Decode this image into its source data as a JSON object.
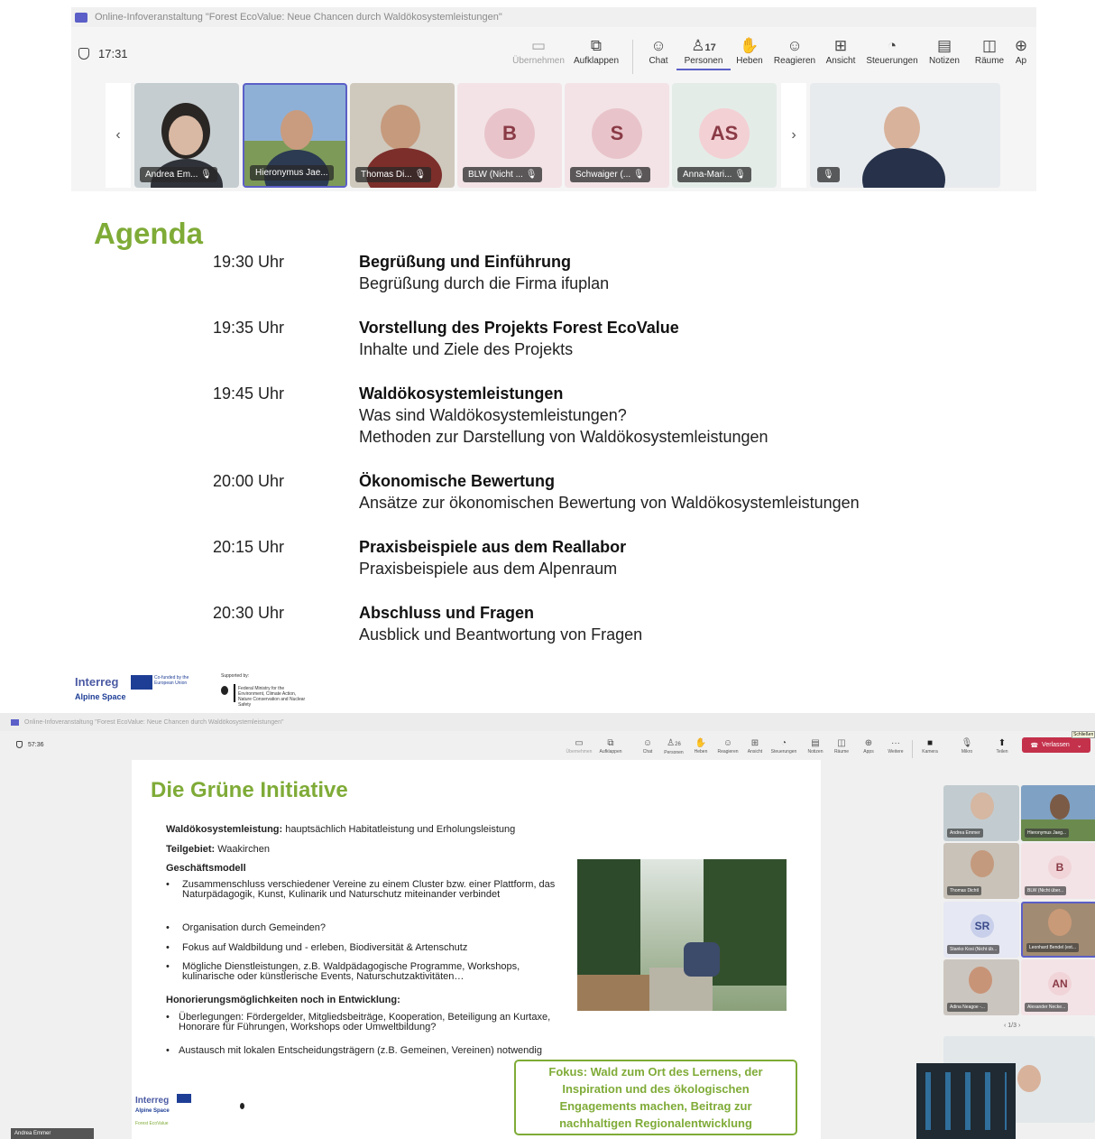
{
  "top": {
    "window_title": "Online-Infoveranstaltung \"Forest EcoValue: Neue Chancen durch Waldökosystemleistungen\"",
    "timer": "17:31",
    "toolbar": [
      {
        "icon": "share-screen-icon",
        "label": "Übernehmen",
        "disabled": true
      },
      {
        "icon": "pop-out-icon",
        "label": "Aufklappen"
      },
      {
        "icon": "chat-icon",
        "label": "Chat"
      },
      {
        "icon": "people-icon",
        "label": "Personen",
        "count": "17",
        "active": true
      },
      {
        "icon": "raise-hand-icon",
        "label": "Heben"
      },
      {
        "icon": "react-icon",
        "label": "Reagieren"
      },
      {
        "icon": "view-icon",
        "label": "Ansicht"
      },
      {
        "icon": "controls-icon",
        "label": "Steuerungen"
      },
      {
        "icon": "notes-icon",
        "label": "Notizen"
      },
      {
        "icon": "rooms-icon",
        "label": "Räume"
      },
      {
        "icon": "apps-icon",
        "label": "Ap"
      }
    ],
    "participants": [
      {
        "name": "Andrea Em...",
        "type": "video"
      },
      {
        "name": "Hieronymus Jae...",
        "type": "video",
        "speaking": true
      },
      {
        "name": "Thomas Di...",
        "type": "video"
      },
      {
        "name": "BLW (Nicht ...",
        "type": "avatar",
        "initials": "B"
      },
      {
        "name": "Schwaiger (...",
        "type": "avatar",
        "initials": "S"
      },
      {
        "name": "Anna-Mari...",
        "type": "avatar",
        "initials": "AS"
      }
    ],
    "slide": {
      "title": "Agenda",
      "items": [
        {
          "time": "19:30 Uhr",
          "heading": "Begrüßung und Einführung",
          "lines": [
            "Begrüßung durch die Firma ifuplan"
          ]
        },
        {
          "time": "19:35 Uhr",
          "heading": "Vorstellung des Projekts Forest EcoValue",
          "lines": [
            "Inhalte und Ziele des Projekts"
          ]
        },
        {
          "time": "19:45 Uhr",
          "heading": "Waldökosystemleistungen",
          "lines": [
            "Was sind Waldökosystemleistungen?",
            "Methoden zur Darstellung von Waldökosystemleistungen"
          ]
        },
        {
          "time": "20:00 Uhr",
          "heading": "Ökonomische Bewertung",
          "lines": [
            "Ansätze zur ökonomischen Bewertung von Waldökosystemleistungen"
          ]
        },
        {
          "time": "20:15 Uhr",
          "heading": "Praxisbeispiele aus dem Reallabor",
          "lines": [
            "Praxisbeispiele aus dem Alpenraum"
          ]
        },
        {
          "time": "20:30 Uhr",
          "heading": "Abschluss und Fragen",
          "lines": [
            "Ausblick und Beantwortung von Fragen"
          ]
        }
      ],
      "footer": {
        "interreg": "Interreg",
        "alpine": "Alpine Space",
        "cofunded": "Co-funded by the European Union",
        "supported": "Supported by:",
        "ministry": "Federal Ministry for the Environment, Climate Action, Nature Conservation and Nuclear Safety"
      }
    }
  },
  "bottom": {
    "window_title": "Online-Infoveranstaltung \"Forest EcoValue: Neue Chancen durch Waldökosystemleistungen\"",
    "timer": "57:36",
    "toolbar": [
      {
        "icon": "share-screen-icon",
        "label": "Übernehmen",
        "disabled": true
      },
      {
        "icon": "pop-out-icon",
        "label": "Aufklappen"
      },
      {
        "icon": "chat-icon",
        "label": "Chat"
      },
      {
        "icon": "people-icon",
        "label": "Personen",
        "count": "26"
      },
      {
        "icon": "raise-hand-icon",
        "label": "Heben"
      },
      {
        "icon": "react-icon",
        "label": "Reagieren"
      },
      {
        "icon": "view-icon",
        "label": "Ansicht"
      },
      {
        "icon": "controls-icon",
        "label": "Steuerungen"
      },
      {
        "icon": "notes-icon",
        "label": "Notizen"
      },
      {
        "icon": "rooms-icon",
        "label": "Räume"
      },
      {
        "icon": "apps-icon",
        "label": "Apps"
      },
      {
        "icon": "more-icon",
        "label": "Weitere"
      },
      {
        "icon": "camera-icon",
        "label": "Kamera"
      },
      {
        "icon": "mic-icon",
        "label": "Mikro"
      },
      {
        "icon": "share-icon",
        "label": "Teilen"
      }
    ],
    "leave_label": "Verlassen",
    "close_label": "Schließen",
    "slide": {
      "title": "Die Grüne Initiative",
      "wsl_label": "Waldökosystemleistung:",
      "wsl_value": "hauptsächlich Habitatleistung und Erholungsleistung",
      "teilgebiet_label": "Teilgebiet:",
      "teilgebiet_value": "Waakirchen",
      "geschaeftsmodell": "Geschäftsmodell",
      "bullets": [
        "Zusammenschluss verschiedener Vereine zu einem Cluster bzw. einer Plattform, das Naturpädagogik, Kunst, Kulinarik und Naturschutz miteinander verbindet",
        "Organisation durch Gemeinden?",
        "Fokus auf Waldbildung und - erleben, Biodiversität & Artenschutz",
        "Mögliche Dienstleistungen, z.B. Waldpädagogische Programme, Workshops, kulinarische oder künstlerische Events, Naturschutzaktivitäten…"
      ],
      "honorierung": "Honorierungsmöglichkeiten noch in Entwicklung:",
      "bullets2": [
        "Überlegungen: Fördergelder, Mitgliedsbeiträge, Kooperation, Beteiligung an Kurtaxe, Honorare für Führungen, Workshops oder Umweltbildung?",
        "Austausch mit lokalen Entscheidungsträgern (z.B. Gemeinen, Vereinen) notwendig"
      ],
      "fokus": "Fokus: Wald zum Ort des Lernens, der Inspiration und des ökologischen Engagements machen, Beitrag zur nachhaltigen Regionalentwicklung",
      "footer_interreg": "Interreg",
      "footer_alpine": "Alpine Space",
      "footer_project": "Forest EcoValue"
    },
    "gallery": [
      {
        "name": "Andrea Emmer",
        "type": "video"
      },
      {
        "name": "Hieronymus Jaeg...",
        "type": "video"
      },
      {
        "name": "Thomas Dichtl",
        "type": "video"
      },
      {
        "name": "BLW (Nicht über...",
        "type": "avatar",
        "initials": "B"
      },
      {
        "name": "Stanko Kosi (Nicht üb...",
        "type": "avatar",
        "initials": "SR"
      },
      {
        "name": "Leonhard Bendel (ext...",
        "type": "video"
      },
      {
        "name": "Adina Neagoe -...",
        "type": "video"
      },
      {
        "name": "Alexander Necke...",
        "type": "avatar",
        "initials": "AN"
      }
    ],
    "pagination": "1/3",
    "self_name": "Andrea Emmer"
  },
  "colors": {
    "accent": "#5b5fc7",
    "slide_green": "#7fab37",
    "leave_red": "#c4314b"
  }
}
